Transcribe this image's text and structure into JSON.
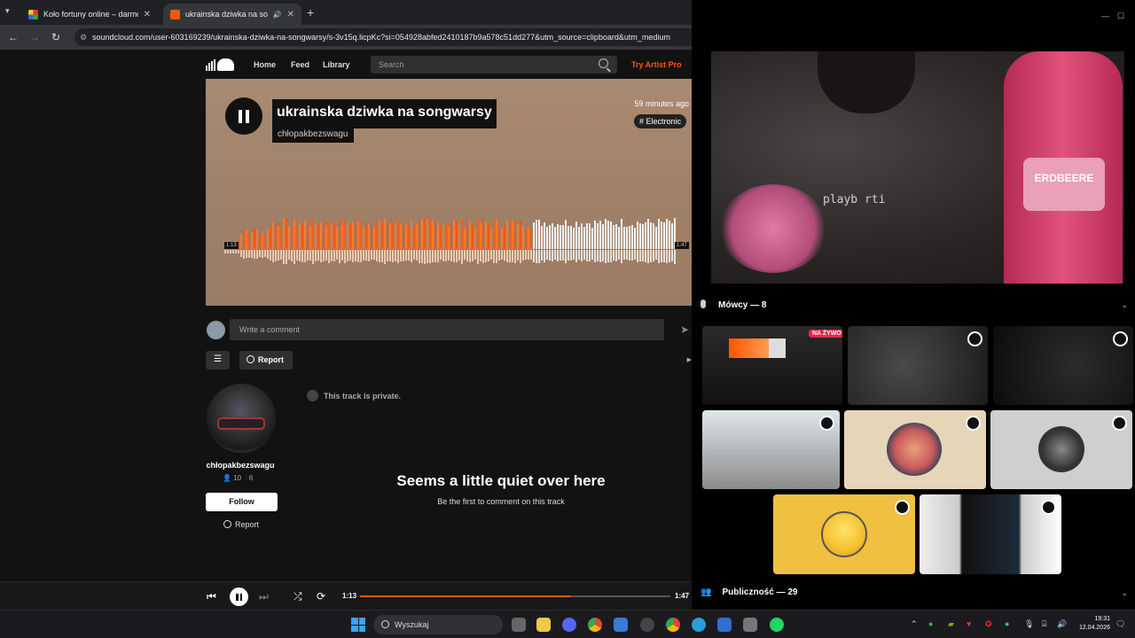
{
  "browser": {
    "tabs": [
      {
        "title": "Koło fortuny online – darmowe"
      },
      {
        "title": "ukrainska dziwka na songw"
      }
    ],
    "new_tab": "+",
    "url": "soundcloud.com/user-603169239/ukrainska-dziwka-na-songwarsy/s-3v15q.licpKc?si=054928abfed2410187b9a578c51dd277&utm_source=clipboard&utm_medium"
  },
  "soundcloud": {
    "nav": {
      "home": "Home",
      "feed": "Feed",
      "library": "Library",
      "search_placeholder": "Search",
      "try_artist": "Try Artist Pro"
    },
    "track": {
      "title": "ukrainska dziwka na songwarsy",
      "artist": "chłopakbezswagu",
      "posted": "59 minutes ago",
      "tag": "# Electronic",
      "time_current": "1:13",
      "time_total": "1:47",
      "progress": 0.68
    },
    "comment_placeholder": "Write a comment",
    "report_label": "Report",
    "private_notice": "This track is private.",
    "user": {
      "name": "chłopakbezswagu",
      "followers": "10",
      "tracks": "6",
      "follow_label": "Follow",
      "report_label": "Report"
    },
    "empty_title": "Seems a little quiet over here",
    "empty_sub": "Be the first to comment on this track",
    "player": {
      "time_current": "1:13",
      "time_total": "1:47",
      "progress": 0.68
    }
  },
  "discord": {
    "stream_overlay_text": "playb    rti",
    "jar_label": "ERDBEERE",
    "speakers_header": "Mówcy — 8",
    "live_badge": "NA ŻYWO",
    "audience_header": "Publiczność — 29"
  },
  "taskbar": {
    "search_label": "Wyszukaj",
    "time": "19:31",
    "date": "12.04.2026"
  },
  "colors": {
    "accent": "#ff5500",
    "live": "#e0294b"
  }
}
